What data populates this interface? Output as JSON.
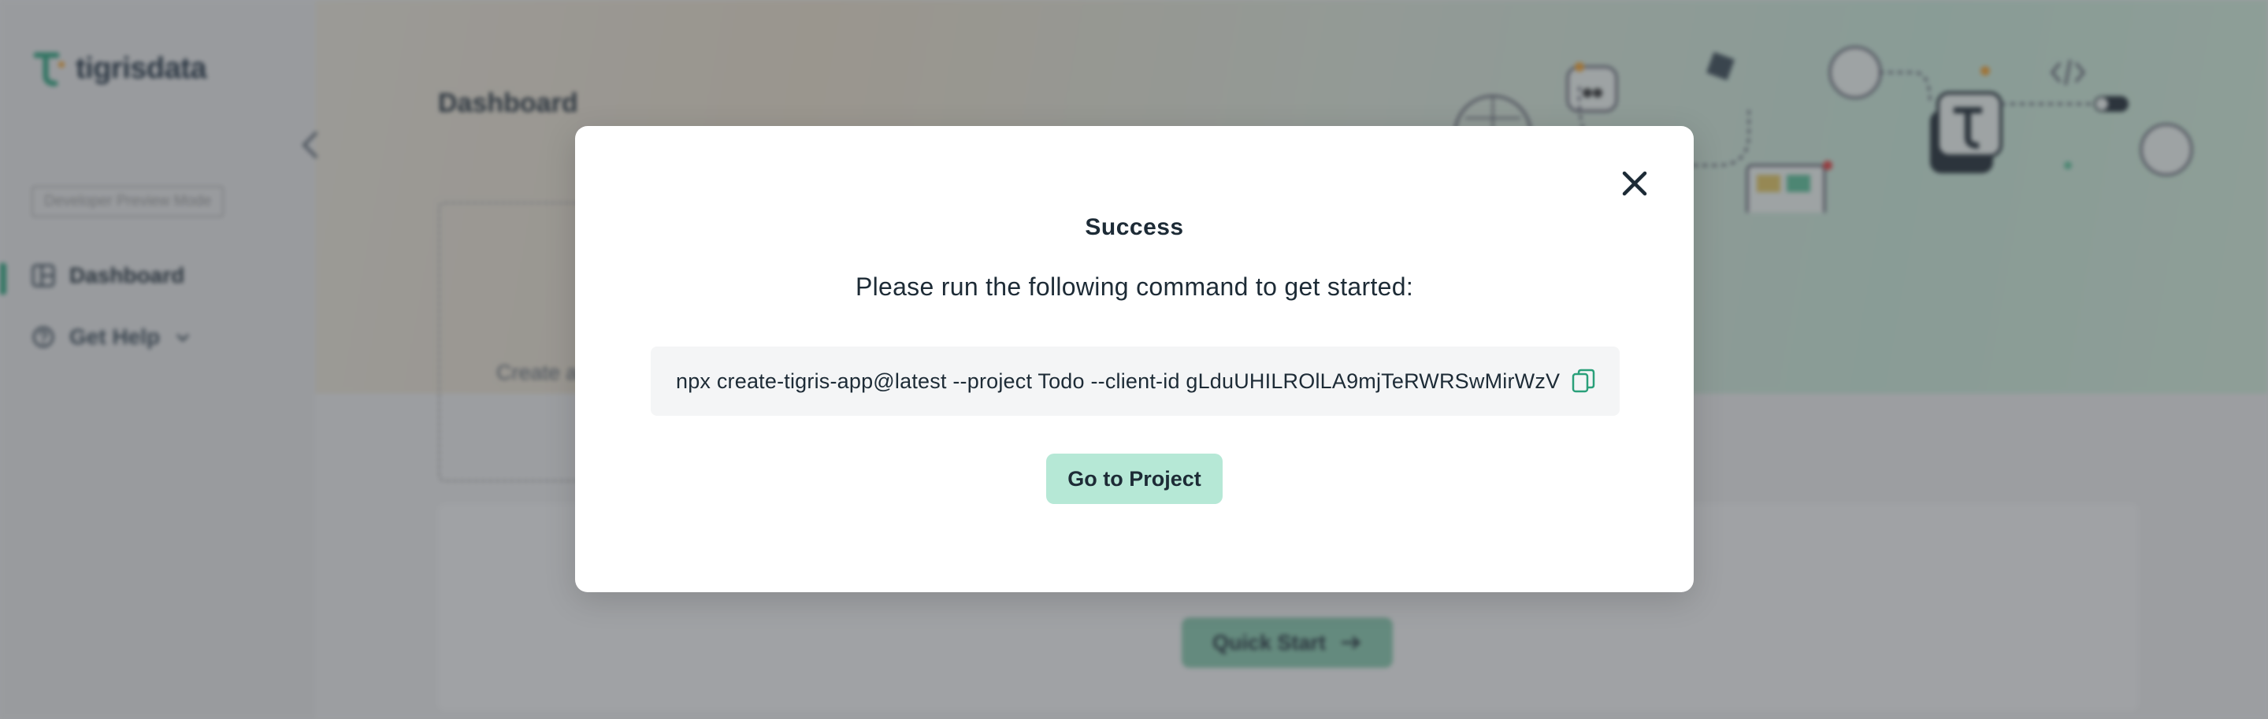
{
  "app": {
    "logo_text": "tigrisdata",
    "preview_badge": "Developer Preview Mode",
    "page_title": "Dashboard",
    "create_card_text": "Create a",
    "quick_start_label": "Quick Start"
  },
  "sidebar": {
    "items": [
      {
        "label": "Dashboard",
        "icon": "dashboard-icon",
        "active": true
      },
      {
        "label": "Get Help",
        "icon": "help-icon",
        "active": false
      }
    ]
  },
  "modal": {
    "title": "Success",
    "subtitle": "Please run the following command to get started:",
    "command": "npx create-tigris-app@latest --project Todo --client-id gLduUHILROlLA9mjTeRWRSwMirWzV",
    "primary_button": "Go to Project"
  },
  "colors": {
    "accent": "#2aa07a",
    "primary_button_bg": "#b6e8d6",
    "text_dark": "#1d2b36"
  }
}
